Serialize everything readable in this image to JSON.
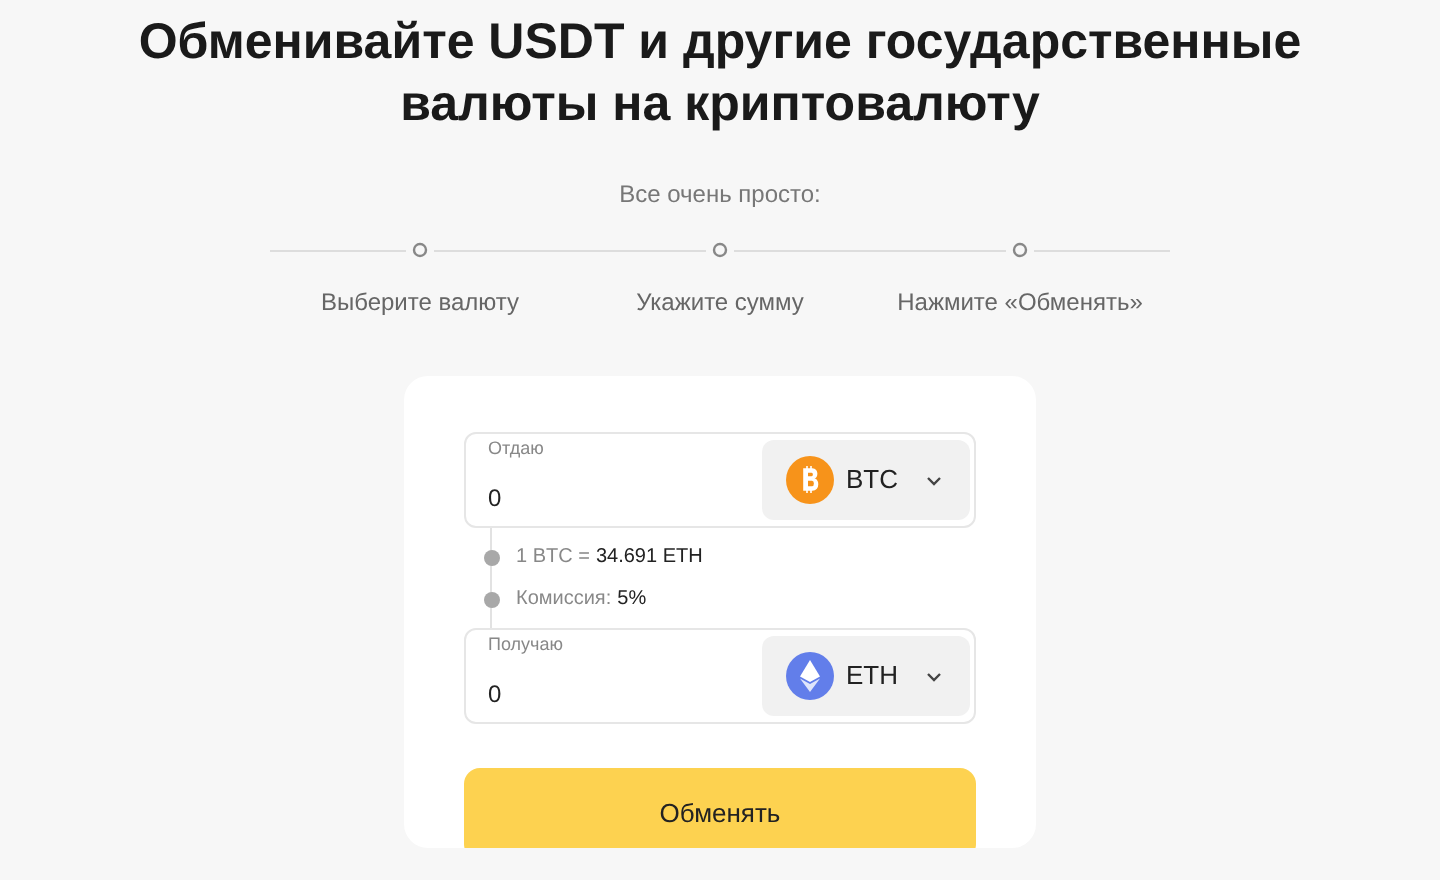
{
  "title": "Обменивайте USDT и другие государственные валюты на криптовалюту",
  "subtitle": "Все очень просто:",
  "steps": [
    {
      "label": "Выберите валюту"
    },
    {
      "label": "Укажите сумму"
    },
    {
      "label": "Нажмите «Обменять»"
    }
  ],
  "exchange": {
    "give": {
      "label": "Отдаю",
      "value": "0",
      "currency": "BTC",
      "kind": "btc"
    },
    "info": [
      {
        "label": "1 BTC =",
        "value": "34.691 ETH"
      },
      {
        "label": "Комиссия:",
        "value": "5%"
      }
    ],
    "receive": {
      "label": "Получаю",
      "value": "0",
      "currency": "ETH",
      "kind": "eth"
    },
    "button": "Обменять"
  }
}
